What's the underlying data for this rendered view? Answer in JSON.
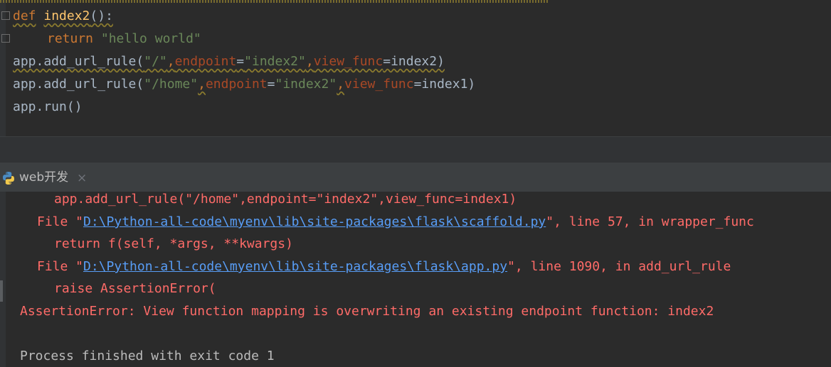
{
  "editor": {
    "line1": {
      "kw": "def",
      "fn": "index2",
      "rest": "():"
    },
    "line2": {
      "kw": "return",
      "str": "\"hello world\""
    },
    "line3": {
      "a": "app.add_url_rule(",
      "s1": "\"/\"",
      "c1": ",",
      "p1": "endpoint",
      "e1": "=",
      "s2": "\"index2\"",
      "c2": ",",
      "p2": "view_func",
      "e2": "=index2)"
    },
    "line4": {
      "a": "app.add_url_rule(",
      "s1": "\"/home\"",
      "c1": ",",
      "p1": "endpoint",
      "e1": "=",
      "s2": "\"index2\"",
      "c2": ",",
      "p2": "view_func",
      "e2": "=index1)"
    },
    "line5": {
      "a": "app.run()"
    }
  },
  "run_tab": {
    "label": "web开发",
    "close": "×",
    "icon": "python-icon"
  },
  "console": {
    "l1": "app.add_url_rule(\"/home\",endpoint=\"index2\",view_func=index1)",
    "l2": {
      "pre": "File \"",
      "link": "D:\\Python-all-code\\myenv\\lib\\site-packages\\flask\\scaffold.py",
      "post": "\", line 57, in wrapper_func"
    },
    "l3": "return f(self, *args, **kwargs)",
    "l4": {
      "pre": "File \"",
      "link": "D:\\Python-all-code\\myenv\\lib\\site-packages\\flask\\app.py",
      "post": "\", line 1090, in add_url_rule"
    },
    "l5": "raise AssertionError(",
    "l6": "AssertionError: View function mapping is overwriting an existing endpoint function: index2",
    "l7": "Process finished with exit code 1"
  },
  "colors": {
    "error": "#ff6b68",
    "link": "#589df6",
    "keyword": "#cc7832",
    "string": "#6a8759"
  }
}
